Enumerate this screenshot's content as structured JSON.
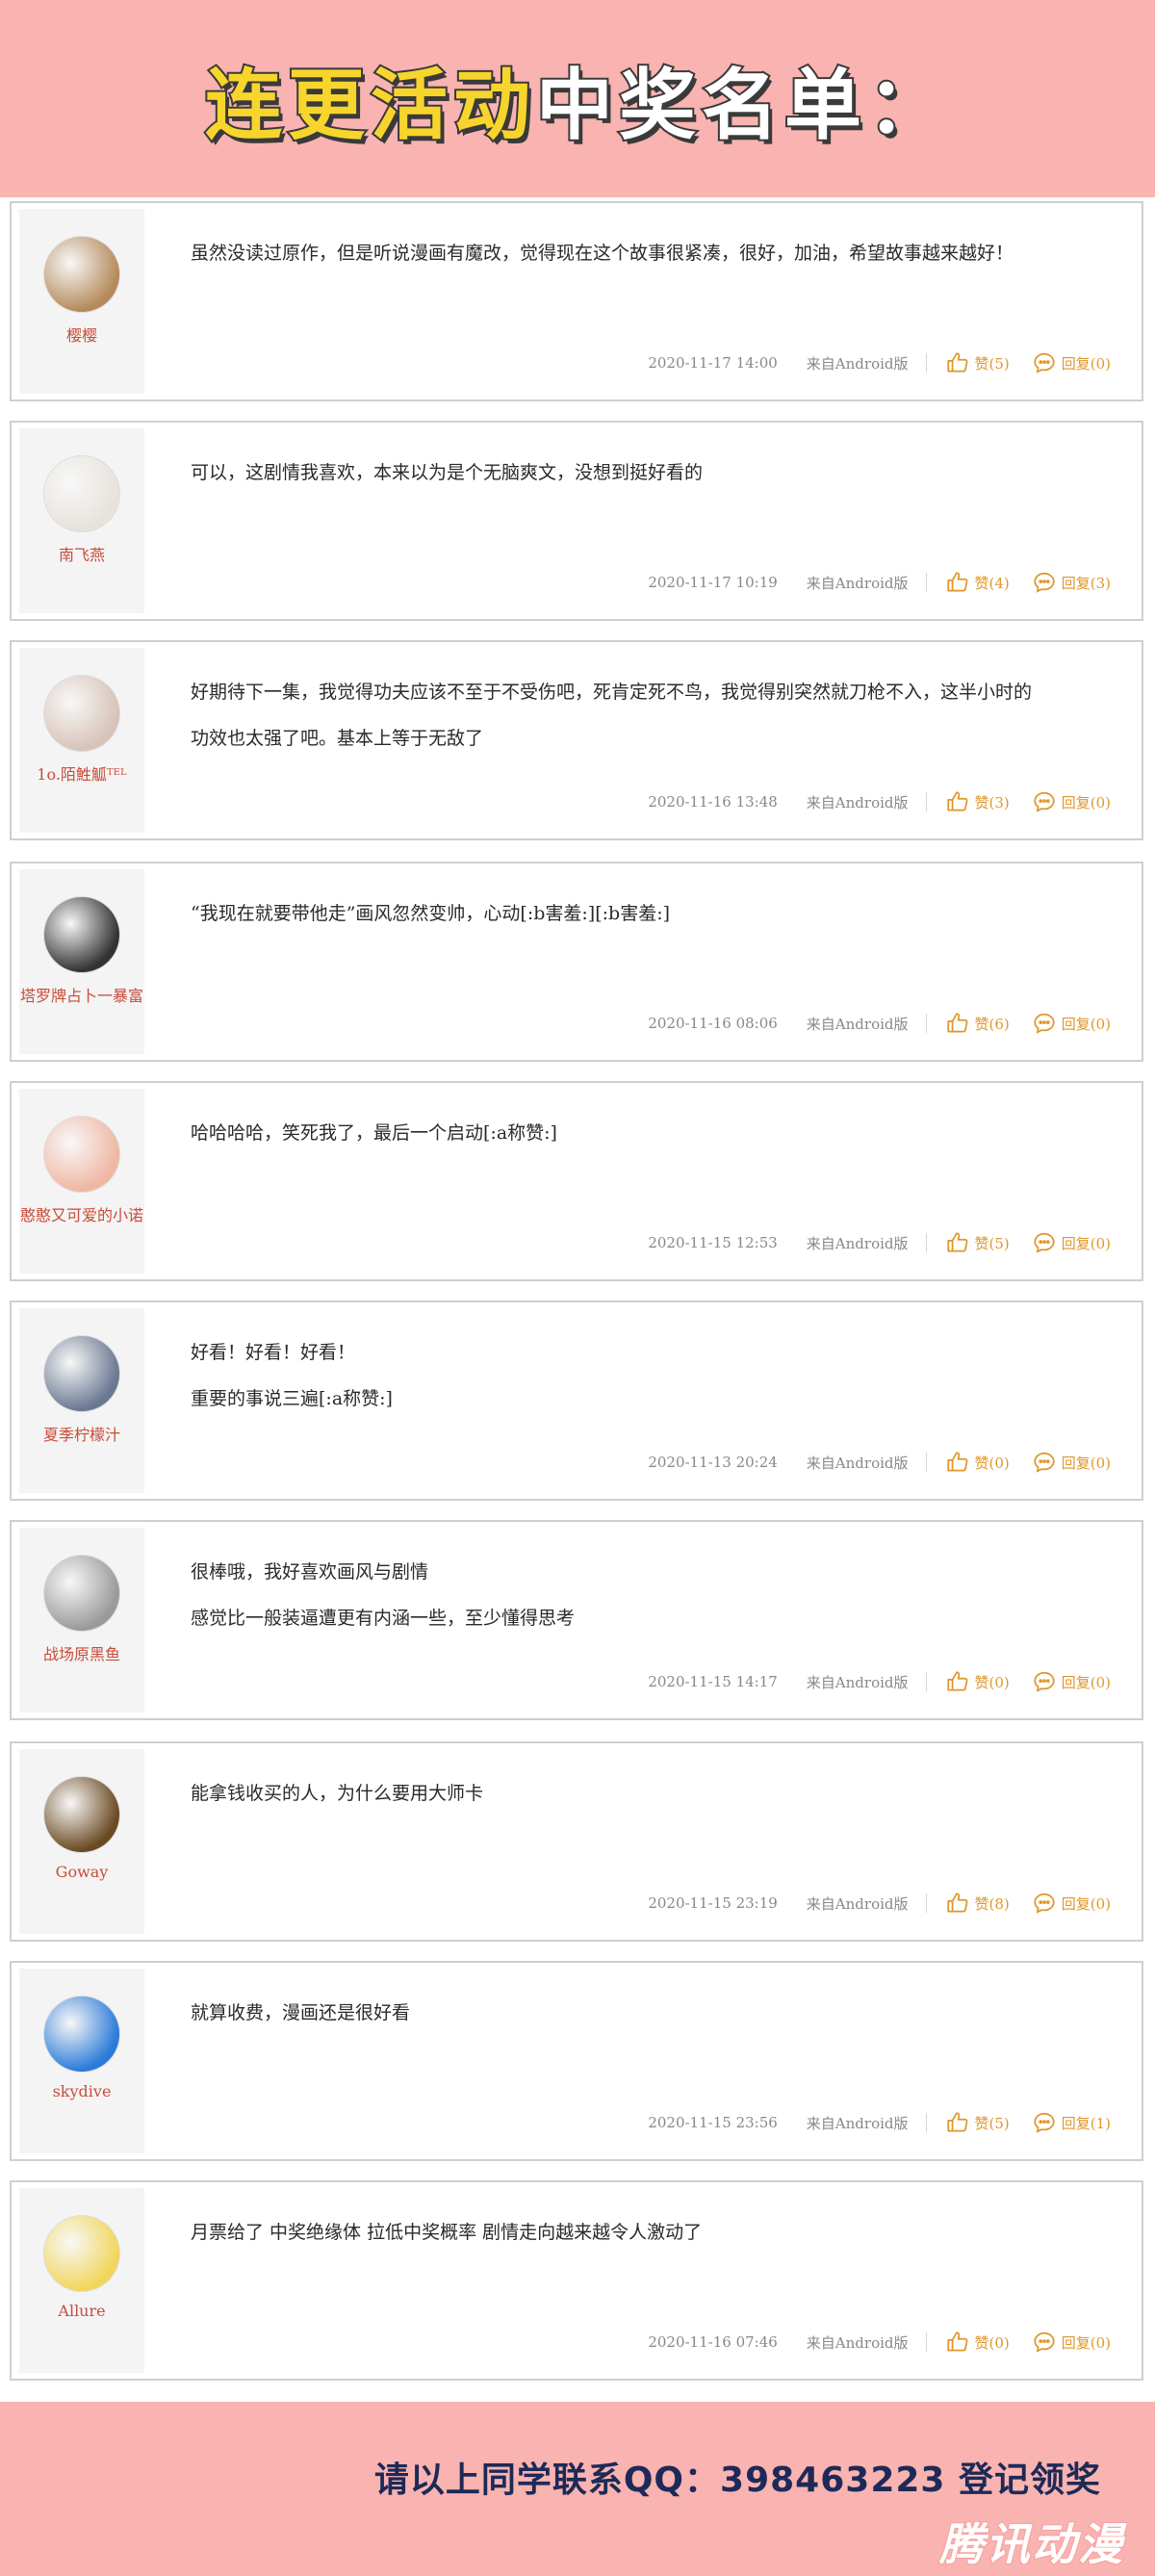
{
  "header": {
    "title_part1": "连更活动",
    "title_part2": "中奖名单："
  },
  "comments": [
    {
      "username": "樱樱",
      "avatar_color": "#b58a5b",
      "lines": [
        "虽然没读过原作，但是听说漫画有魔改，觉得现在这个故事很紧凑，很好，加油，希望故事越来越好！"
      ],
      "time": "2020-11-17 14:00",
      "source": "来自Android版",
      "like_label": "赞(5)",
      "reply_label": "回复(0)"
    },
    {
      "username": "南飞燕",
      "avatar_color": "#e8e2dc",
      "lines": [
        "可以，这剧情我喜欢，本来以为是个无脑爽文，没想到挺好看的"
      ],
      "time": "2020-11-17 10:19",
      "source": "来自Android版",
      "like_label": "赞(4)",
      "reply_label": "回复(3)"
    },
    {
      "username": "1o.陌鮏觚ᵀᴱᴸ",
      "avatar_color": "#d8c3b8",
      "lines": [
        "好期待下一集，我觉得功夫应该不至于不受伤吧，死肯定死不鸟，我觉得别突然就刀枪不入，这半小时的",
        "功效也太强了吧。基本上等于无敌了"
      ],
      "time": "2020-11-16 13:48",
      "source": "来自Android版",
      "like_label": "赞(3)",
      "reply_label": "回复(0)"
    },
    {
      "username": "塔罗牌占卜一暴富",
      "avatar_color": "#333333",
      "lines": [
        "“我现在就要带他走”画风忽然变帅，心动[:b害羞:][:b害羞:]"
      ],
      "time": "2020-11-16 08:06",
      "source": "来自Android版",
      "like_label": "赞(6)",
      "reply_label": "回复(0)"
    },
    {
      "username": "憨憨又可爱的小诺",
      "avatar_color": "#f0b7a3",
      "lines": [
        "哈哈哈哈，笑死我了，最后一个启动[:a称赞:]"
      ],
      "time": "2020-11-15 12:53",
      "source": "来自Android版",
      "like_label": "赞(5)",
      "reply_label": "回复(0)"
    },
    {
      "username": "夏季柠檬汁",
      "avatar_color": "#6a7891",
      "lines": [
        "好看！好看！好看！",
        "重要的事说三遍[:a称赞:]"
      ],
      "time": "2020-11-13 20:24",
      "source": "来自Android版",
      "like_label": "赞(0)",
      "reply_label": "回复(0)"
    },
    {
      "username": "战场原黑鱼",
      "avatar_color": "#9a9a9a",
      "lines": [
        "很棒哦，我好喜欢画风与剧情",
        "感觉比一般装逼遭更有内涵一些，至少懂得思考"
      ],
      "time": "2020-11-15 14:17",
      "source": "来自Android版",
      "like_label": "赞(0)",
      "reply_label": "回复(0)"
    },
    {
      "username": "Goway",
      "avatar_color": "#6b4a22",
      "lines": [
        "能拿钱收买的人，为什么要用大师卡"
      ],
      "time": "2020-11-15 23:19",
      "source": "来自Android版",
      "like_label": "赞(8)",
      "reply_label": "回复(0)"
    },
    {
      "username": "skydive",
      "avatar_color": "#2b7bd8",
      "lines": [
        "就算收费，漫画还是很好看"
      ],
      "time": "2020-11-15 23:56",
      "source": "来自Android版",
      "like_label": "赞(5)",
      "reply_label": "回复(1)"
    },
    {
      "username": "Allure",
      "avatar_color": "#f2d65c",
      "lines": [
        "月票给了 中奖绝缘体 拉低中奖概率 剧情走向越来越令人激动了"
      ],
      "time": "2020-11-16 07:46",
      "source": "来自Android版",
      "like_label": "赞(0)",
      "reply_label": "回复(0)"
    }
  ],
  "footer": {
    "contact": "请以上同学联系QQ：398463223 登记领奖",
    "watermark": "腾讯动漫"
  },
  "colors": {
    "background_pink": "#f9b3b1",
    "accent_orange": "#e0962a",
    "username_red": "#c94c3a"
  },
  "icons": {
    "like": "thumbs-up-icon",
    "reply": "speech-bubble-icon"
  }
}
